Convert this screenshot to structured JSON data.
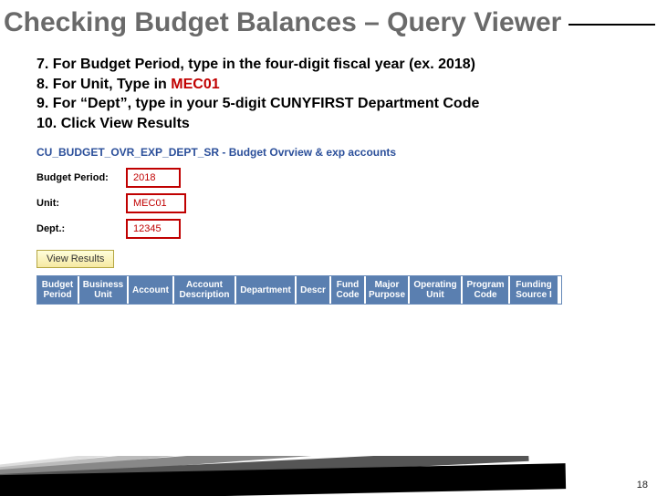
{
  "title": "Checking Budget Balances – Query Viewer",
  "instructions": [
    {
      "num": "7.",
      "text": "For Budget Period, type in the four-digit fiscal year (ex. 2018)"
    },
    {
      "num": "8.",
      "prefix": "For Unit, Type in ",
      "highlight": "MEC01",
      "suffix": ""
    },
    {
      "num": "9.",
      "text": "For “Dept”, type in your 5-digit CUNYFIRST Department Code"
    },
    {
      "num": "10.",
      "text": "Click View Results"
    }
  ],
  "query": {
    "name": "CU_BUDGET_OVR_EXP_DEPT_SR - Budget Ovrview & exp accounts",
    "fields": {
      "budget_period_label": "Budget Period:",
      "budget_period_value": "2018",
      "unit_label": "Unit:",
      "unit_value": "MEC01",
      "dept_label": "Dept.:",
      "dept_value": "12345"
    },
    "button_label": "View Results",
    "columns": [
      "Budget Period",
      "Business Unit",
      "Account",
      "Account Description",
      "Department",
      "Descr",
      "Fund Code",
      "Major Purpose",
      "Operating Unit",
      "Program Code",
      "Funding Source I"
    ]
  },
  "page_number": "18"
}
